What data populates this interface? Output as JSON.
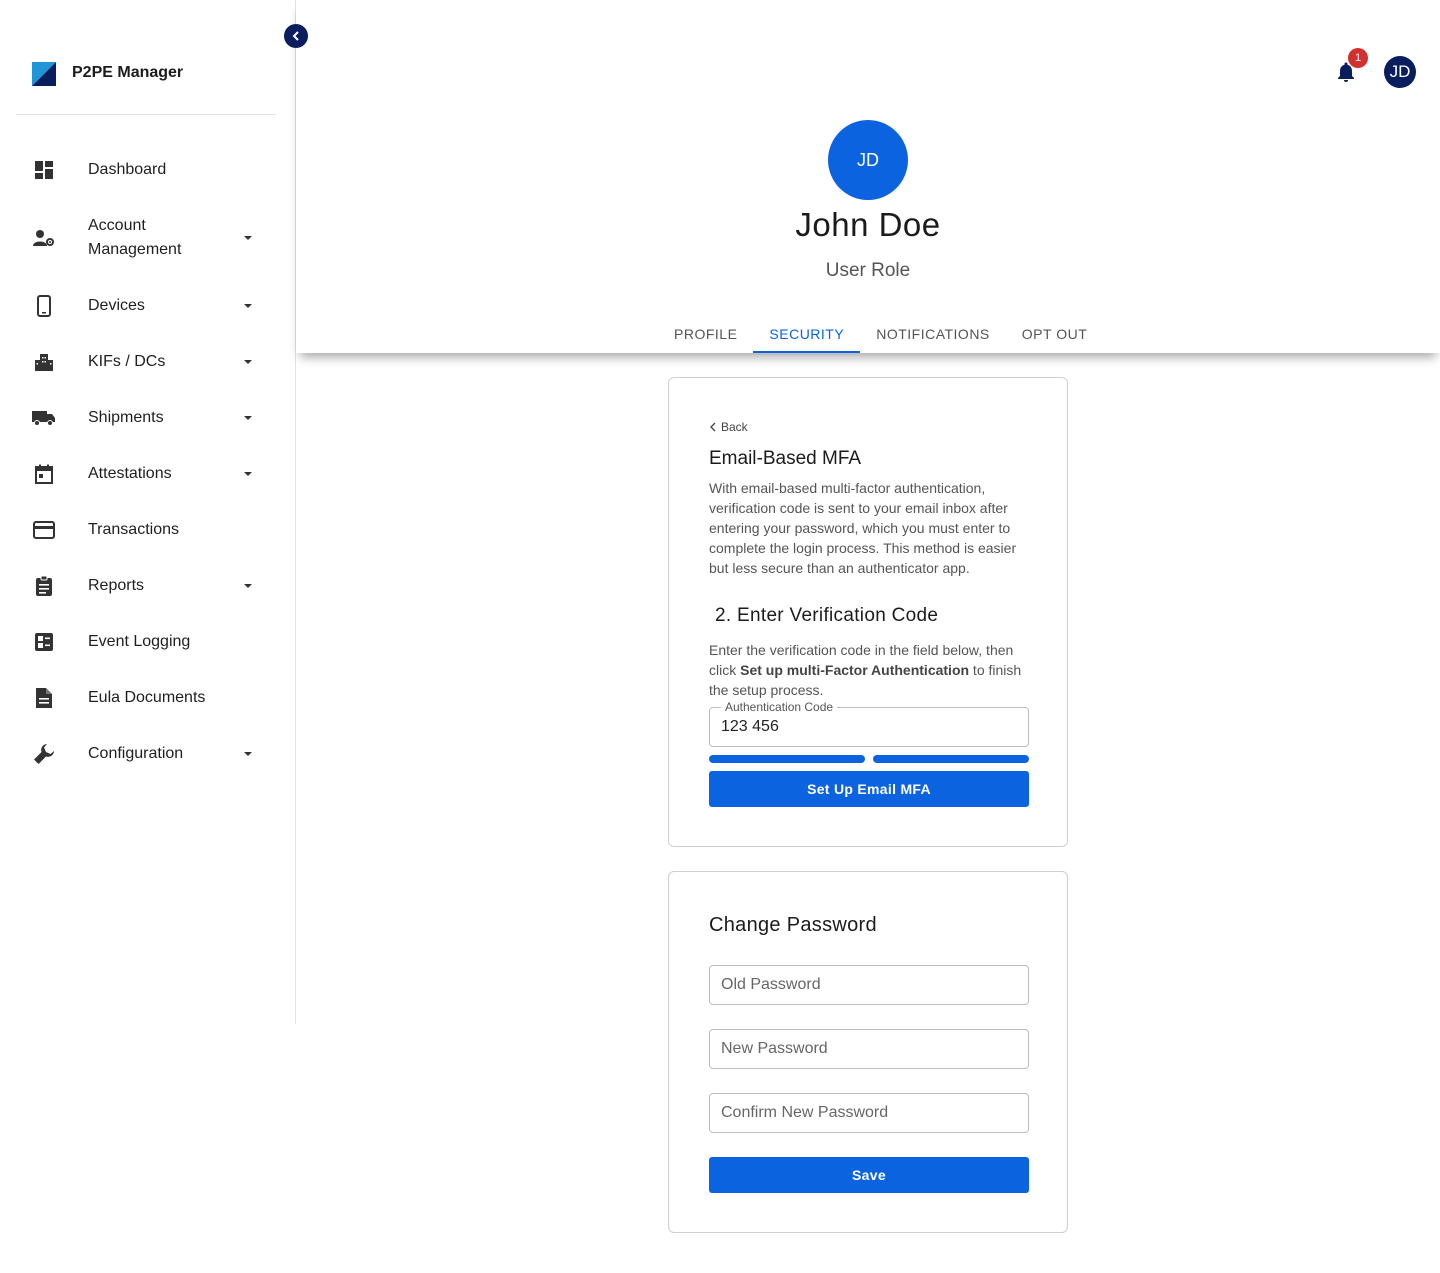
{
  "app": {
    "name": "P2PE Manager"
  },
  "sidebar": {
    "items": [
      {
        "label": "Dashboard",
        "icon": "dashboard-icon",
        "expandable": false
      },
      {
        "label": "Account Management",
        "icon": "account-management-icon",
        "expandable": true
      },
      {
        "label": "Devices",
        "icon": "smartphone-icon",
        "expandable": true
      },
      {
        "label": "KIFs / DCs",
        "icon": "building-icon",
        "expandable": true
      },
      {
        "label": "Shipments",
        "icon": "truck-icon",
        "expandable": true
      },
      {
        "label": "Attestations",
        "icon": "calendar-icon",
        "expandable": true
      },
      {
        "label": "Transactions",
        "icon": "credit-card-icon",
        "expandable": false
      },
      {
        "label": "Reports",
        "icon": "clipboard-icon",
        "expandable": true
      },
      {
        "label": "Event Logging",
        "icon": "event-list-icon",
        "expandable": false
      },
      {
        "label": "Eula Documents",
        "icon": "document-icon",
        "expandable": false
      },
      {
        "label": "Configuration",
        "icon": "wrench-icon",
        "expandable": true
      }
    ]
  },
  "header": {
    "notification_count": "1",
    "avatar_initials": "JD"
  },
  "profile": {
    "initials": "JD",
    "name": "John Doe",
    "role": "User Role"
  },
  "tabs": [
    {
      "label": "PROFILE",
      "active": false
    },
    {
      "label": "SECURITY",
      "active": true
    },
    {
      "label": "NOTIFICATIONS",
      "active": false
    },
    {
      "label": "OPT OUT",
      "active": false
    }
  ],
  "mfa": {
    "back_label": "Back",
    "title": "Email-Based MFA",
    "description": "With email-based multi-factor authentication, verification code is sent to your email inbox after entering your password, which you must enter to complete the login process. This method is easier but less secure than  an authenticator app.",
    "step_title": "2. Enter Verification Code",
    "step_desc_before": "Enter the verification code in the field below, then click ",
    "step_desc_bold": "Set up multi-Factor Authentication",
    "step_desc_after": " to finish the setup process.",
    "auth_label": "Authentication Code",
    "auth_value": "123 456",
    "progress_steps": 2,
    "progress_completed": 2,
    "button_label": "Set Up Email MFA"
  },
  "password": {
    "title": "Change Password",
    "old_placeholder": "Old Password",
    "new_placeholder": "New Password",
    "confirm_placeholder": "Confirm New Password",
    "save_label": "Save"
  },
  "colors": {
    "primary": "#0b63e0",
    "navy": "#0a1e5e",
    "badge": "#d32f2f"
  }
}
